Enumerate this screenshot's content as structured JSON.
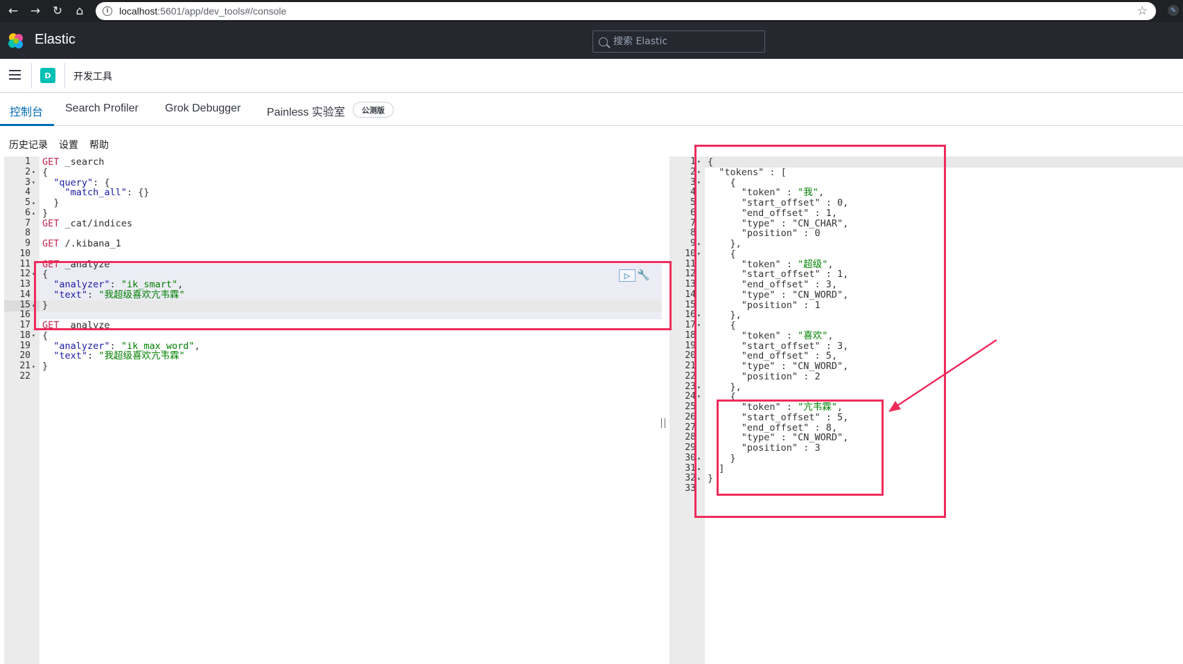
{
  "browser": {
    "url_host": "localhost",
    "url_path": ":5601/app/dev_tools#/console"
  },
  "header": {
    "brand": "Elastic",
    "search_placeholder": "搜索 Elastic"
  },
  "breadcrumb": {
    "space_initial": "D",
    "title": "开发工具"
  },
  "tabs": [
    {
      "label": "控制台",
      "active": true
    },
    {
      "label": "Search Profiler",
      "active": false
    },
    {
      "label": "Grok Debugger",
      "active": false
    },
    {
      "label": "Painless 实验室",
      "active": false
    }
  ],
  "beta_badge": "公测版",
  "submenu": [
    "历史记录",
    "设置",
    "帮助"
  ],
  "request_editor": {
    "lines": [
      {
        "n": "1",
        "fold": "",
        "tokens": [
          [
            "method",
            "GET"
          ],
          [
            "url",
            " _search"
          ]
        ]
      },
      {
        "n": "2",
        "fold": "▾",
        "tokens": [
          [
            "punct",
            "{"
          ]
        ]
      },
      {
        "n": "3",
        "fold": "▾",
        "tokens": [
          [
            "punct",
            "  "
          ],
          [
            "key",
            "\"query\""
          ],
          [
            "punct",
            ": {"
          ]
        ]
      },
      {
        "n": "4",
        "fold": "",
        "tokens": [
          [
            "punct",
            "    "
          ],
          [
            "key",
            "\"match_all\""
          ],
          [
            "punct",
            ": {}"
          ]
        ]
      },
      {
        "n": "5",
        "fold": "▴",
        "tokens": [
          [
            "punct",
            "  }"
          ]
        ]
      },
      {
        "n": "6",
        "fold": "▴",
        "tokens": [
          [
            "punct",
            "}"
          ]
        ]
      },
      {
        "n": "7",
        "fold": "",
        "tokens": [
          [
            "method",
            "GET"
          ],
          [
            "url",
            " _cat/indices"
          ]
        ]
      },
      {
        "n": "8",
        "fold": "",
        "tokens": []
      },
      {
        "n": "9",
        "fold": "",
        "tokens": [
          [
            "method",
            "GET"
          ],
          [
            "url",
            " /.kibana_1"
          ]
        ]
      },
      {
        "n": "10",
        "fold": "",
        "tokens": []
      },
      {
        "n": "11",
        "fold": "",
        "tokens": [
          [
            "method",
            "GET"
          ],
          [
            "url",
            " _analyze"
          ]
        ]
      },
      {
        "n": "12",
        "fold": "▾",
        "tokens": [
          [
            "punct",
            "{"
          ]
        ]
      },
      {
        "n": "13",
        "fold": "",
        "tokens": [
          [
            "punct",
            "  "
          ],
          [
            "key",
            "\"analyzer\""
          ],
          [
            "punct",
            ": "
          ],
          [
            "str",
            "\"ik_smart\""
          ],
          [
            "punct",
            ","
          ]
        ]
      },
      {
        "n": "14",
        "fold": "",
        "tokens": [
          [
            "punct",
            "  "
          ],
          [
            "key",
            "\"text\""
          ],
          [
            "punct",
            ": "
          ],
          [
            "str",
            "\"我超级喜欢亢韦霖\""
          ]
        ]
      },
      {
        "n": "15",
        "fold": "▴",
        "tokens": [
          [
            "punct",
            "}"
          ]
        ]
      },
      {
        "n": "16",
        "fold": "",
        "tokens": []
      },
      {
        "n": "17",
        "fold": "",
        "tokens": [
          [
            "method",
            "GET"
          ],
          [
            "url",
            " _analyze"
          ]
        ]
      },
      {
        "n": "18",
        "fold": "▾",
        "tokens": [
          [
            "punct",
            "{"
          ]
        ]
      },
      {
        "n": "19",
        "fold": "",
        "tokens": [
          [
            "punct",
            "  "
          ],
          [
            "key",
            "\"analyzer\""
          ],
          [
            "punct",
            ": "
          ],
          [
            "str",
            "\"ik_max_word\""
          ],
          [
            "punct",
            ","
          ]
        ]
      },
      {
        "n": "20",
        "fold": "",
        "tokens": [
          [
            "punct",
            "  "
          ],
          [
            "key",
            "\"text\""
          ],
          [
            "punct",
            ": "
          ],
          [
            "str",
            "\"我超级喜欢亢韦霖\""
          ]
        ]
      },
      {
        "n": "21",
        "fold": "▴",
        "tokens": [
          [
            "punct",
            "}"
          ]
        ]
      },
      {
        "n": "22",
        "fold": "",
        "tokens": []
      }
    ]
  },
  "response_editor": {
    "lines": [
      {
        "n": "1",
        "fold": "▾",
        "tokens": [
          [
            "punct",
            "{"
          ]
        ]
      },
      {
        "n": "2",
        "fold": "▾",
        "tokens": [
          [
            "punct",
            "  "
          ],
          [
            "word",
            "\"tokens\""
          ],
          [
            "punct",
            " : ["
          ]
        ]
      },
      {
        "n": "3",
        "fold": "▾",
        "tokens": [
          [
            "punct",
            "    {"
          ]
        ]
      },
      {
        "n": "4",
        "fold": "",
        "tokens": [
          [
            "punct",
            "      "
          ],
          [
            "word",
            "\"token\""
          ],
          [
            "punct",
            " : "
          ],
          [
            "str",
            "\"我\""
          ],
          [
            "punct",
            ","
          ]
        ]
      },
      {
        "n": "5",
        "fold": "",
        "tokens": [
          [
            "punct",
            "      "
          ],
          [
            "word",
            "\"start_offset\""
          ],
          [
            "punct",
            " : 0,"
          ]
        ]
      },
      {
        "n": "6",
        "fold": "",
        "tokens": [
          [
            "punct",
            "      "
          ],
          [
            "word",
            "\"end_offset\""
          ],
          [
            "punct",
            " : 1,"
          ]
        ]
      },
      {
        "n": "7",
        "fold": "",
        "tokens": [
          [
            "punct",
            "      "
          ],
          [
            "word",
            "\"type\""
          ],
          [
            "punct",
            " : "
          ],
          [
            "word",
            "\"CN_CHAR\""
          ],
          [
            "punct",
            ","
          ]
        ]
      },
      {
        "n": "8",
        "fold": "",
        "tokens": [
          [
            "punct",
            "      "
          ],
          [
            "word",
            "\"position\""
          ],
          [
            "punct",
            " : 0"
          ]
        ]
      },
      {
        "n": "9",
        "fold": "▴",
        "tokens": [
          [
            "punct",
            "    },"
          ]
        ]
      },
      {
        "n": "10",
        "fold": "▾",
        "tokens": [
          [
            "punct",
            "    {"
          ]
        ]
      },
      {
        "n": "11",
        "fold": "",
        "tokens": [
          [
            "punct",
            "      "
          ],
          [
            "word",
            "\"token\""
          ],
          [
            "punct",
            " : "
          ],
          [
            "str",
            "\"超级\""
          ],
          [
            "punct",
            ","
          ]
        ]
      },
      {
        "n": "12",
        "fold": "",
        "tokens": [
          [
            "punct",
            "      "
          ],
          [
            "word",
            "\"start_offset\""
          ],
          [
            "punct",
            " : 1,"
          ]
        ]
      },
      {
        "n": "13",
        "fold": "",
        "tokens": [
          [
            "punct",
            "      "
          ],
          [
            "word",
            "\"end_offset\""
          ],
          [
            "punct",
            " : 3,"
          ]
        ]
      },
      {
        "n": "14",
        "fold": "",
        "tokens": [
          [
            "punct",
            "      "
          ],
          [
            "word",
            "\"type\""
          ],
          [
            "punct",
            " : "
          ],
          [
            "word",
            "\"CN_WORD\""
          ],
          [
            "punct",
            ","
          ]
        ]
      },
      {
        "n": "15",
        "fold": "",
        "tokens": [
          [
            "punct",
            "      "
          ],
          [
            "word",
            "\"position\""
          ],
          [
            "punct",
            " : 1"
          ]
        ]
      },
      {
        "n": "16",
        "fold": "▴",
        "tokens": [
          [
            "punct",
            "    },"
          ]
        ]
      },
      {
        "n": "17",
        "fold": "▾",
        "tokens": [
          [
            "punct",
            "    {"
          ]
        ]
      },
      {
        "n": "18",
        "fold": "",
        "tokens": [
          [
            "punct",
            "      "
          ],
          [
            "word",
            "\"token\""
          ],
          [
            "punct",
            " : "
          ],
          [
            "str",
            "\"喜欢\""
          ],
          [
            "punct",
            ","
          ]
        ]
      },
      {
        "n": "19",
        "fold": "",
        "tokens": [
          [
            "punct",
            "      "
          ],
          [
            "word",
            "\"start_offset\""
          ],
          [
            "punct",
            " : 3,"
          ]
        ]
      },
      {
        "n": "20",
        "fold": "",
        "tokens": [
          [
            "punct",
            "      "
          ],
          [
            "word",
            "\"end_offset\""
          ],
          [
            "punct",
            " : 5,"
          ]
        ]
      },
      {
        "n": "21",
        "fold": "",
        "tokens": [
          [
            "punct",
            "      "
          ],
          [
            "word",
            "\"type\""
          ],
          [
            "punct",
            " : "
          ],
          [
            "word",
            "\"CN_WORD\""
          ],
          [
            "punct",
            ","
          ]
        ]
      },
      {
        "n": "22",
        "fold": "",
        "tokens": [
          [
            "punct",
            "      "
          ],
          [
            "word",
            "\"position\""
          ],
          [
            "punct",
            " : 2"
          ]
        ]
      },
      {
        "n": "23",
        "fold": "▴",
        "tokens": [
          [
            "punct",
            "    },"
          ]
        ]
      },
      {
        "n": "24",
        "fold": "▾",
        "tokens": [
          [
            "punct",
            "    {"
          ]
        ]
      },
      {
        "n": "25",
        "fold": "",
        "tokens": [
          [
            "punct",
            "      "
          ],
          [
            "word",
            "\"token\""
          ],
          [
            "punct",
            " : "
          ],
          [
            "str",
            "\"亢韦霖\""
          ],
          [
            "punct",
            ","
          ]
        ]
      },
      {
        "n": "26",
        "fold": "",
        "tokens": [
          [
            "punct",
            "      "
          ],
          [
            "word",
            "\"start_offset\""
          ],
          [
            "punct",
            " : 5,"
          ]
        ]
      },
      {
        "n": "27",
        "fold": "",
        "tokens": [
          [
            "punct",
            "      "
          ],
          [
            "word",
            "\"end_offset\""
          ],
          [
            "punct",
            " : 8,"
          ]
        ]
      },
      {
        "n": "28",
        "fold": "",
        "tokens": [
          [
            "punct",
            "      "
          ],
          [
            "word",
            "\"type\""
          ],
          [
            "punct",
            " : "
          ],
          [
            "word",
            "\"CN_WORD\""
          ],
          [
            "punct",
            ","
          ]
        ]
      },
      {
        "n": "29",
        "fold": "",
        "tokens": [
          [
            "punct",
            "      "
          ],
          [
            "word",
            "\"position\""
          ],
          [
            "punct",
            " : 3"
          ]
        ]
      },
      {
        "n": "30",
        "fold": "▴",
        "tokens": [
          [
            "punct",
            "    }"
          ]
        ]
      },
      {
        "n": "31",
        "fold": "▴",
        "tokens": [
          [
            "punct",
            "  ]"
          ]
        ]
      },
      {
        "n": "32",
        "fold": "▴",
        "tokens": [
          [
            "punct",
            "}"
          ]
        ]
      },
      {
        "n": "33",
        "fold": "",
        "tokens": []
      }
    ]
  },
  "colors": {
    "annotation": "#ee2b5b",
    "accent": "#006bb4",
    "space_avatar": "#00bfb3"
  },
  "icons": [
    "back-icon",
    "forward-icon",
    "reload-icon",
    "home-icon",
    "info-icon",
    "star-icon",
    "extension-icon",
    "elastic-logo-icon",
    "search-icon",
    "menu-icon",
    "play-icon",
    "wrench-icon"
  ]
}
